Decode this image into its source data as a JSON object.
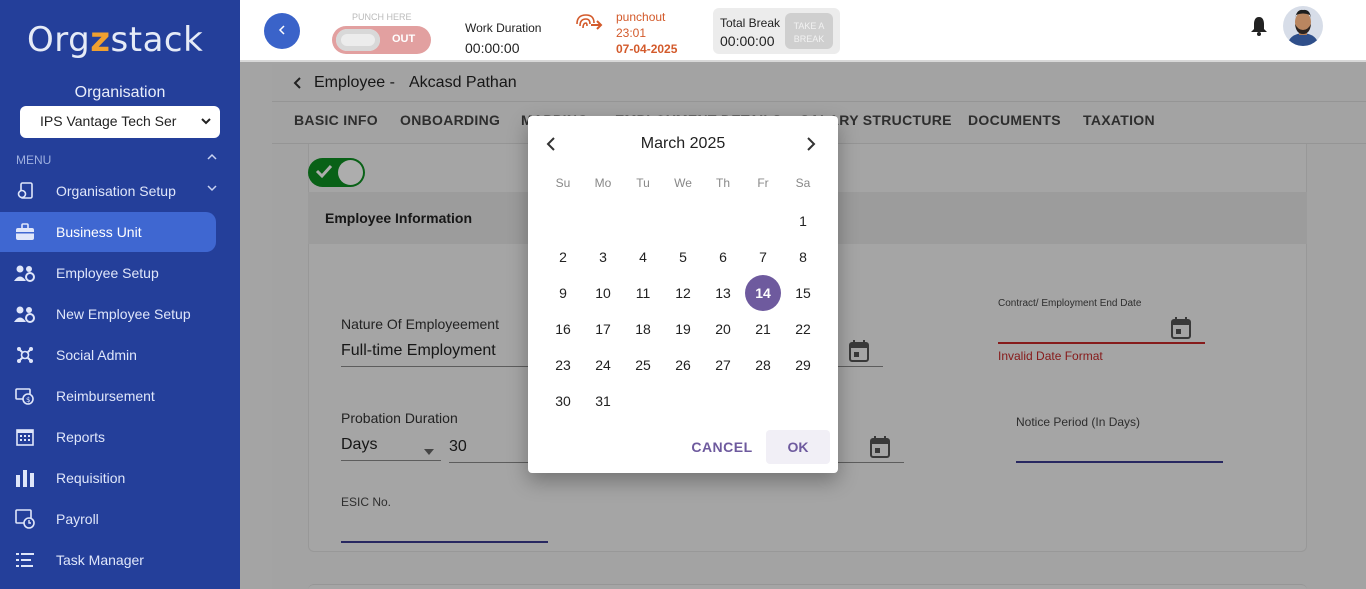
{
  "sidebar": {
    "logo": {
      "prefix": "Org",
      "mid": "z",
      "suffix": "stack"
    },
    "organisation_label": "Organisation",
    "organisation_selected": "IPS Vantage Tech Ser",
    "menu_label": "MENU",
    "items": [
      {
        "label": "Organisation Setup",
        "icon": "settings-doc-icon"
      },
      {
        "label": "Business Unit",
        "icon": "briefcase-icon"
      },
      {
        "label": "Employee Setup",
        "icon": "people-gear-icon"
      },
      {
        "label": "New Employee Setup",
        "icon": "people-gear-icon"
      },
      {
        "label": "Social Admin",
        "icon": "network-icon"
      },
      {
        "label": "Reimbursement",
        "icon": "money-cycle-icon"
      },
      {
        "label": "Reports",
        "icon": "grid-calendar-icon"
      },
      {
        "label": "Requisition",
        "icon": "bar-chart-icon"
      },
      {
        "label": "Payroll",
        "icon": "payroll-icon"
      },
      {
        "label": "Task Manager",
        "icon": "list-icon"
      }
    ]
  },
  "header": {
    "punch_label": "PUNCH HERE",
    "punch_state": "OUT",
    "work_duration_title": "Work Duration",
    "work_duration_value": "00:00:00",
    "punch_status": "punchout",
    "punch_time": "23:01",
    "punch_date": "07-04-2025",
    "break_title": "Total Break",
    "break_value": "00:00:00",
    "take_break_label": "TAKE A BREAK"
  },
  "breadcrumb": {
    "prefix": "Employee -",
    "name": "Akcasd Pathan"
  },
  "tabs": [
    "BASIC INFO",
    "ONBOARDING",
    "MAPPING",
    "EMPLOYMENT DETAILS",
    "SALARY STRUCTURE",
    "DOCUMENTS",
    "TAXATION"
  ],
  "form": {
    "section_title": "Employee Information",
    "nature_label": "Nature Of Employeement",
    "nature_value": "Full-time Employment",
    "contract_end_label": "Contract/ Employment End Date",
    "contract_end_error": "Invalid Date Format",
    "probation_label": "Probation Duration",
    "probation_unit": "Days",
    "probation_value": "30",
    "notice_label": "Notice Period (In Days)",
    "esic_label": "ESIC No."
  },
  "datepicker": {
    "month_title": "March 2025",
    "weekdays": [
      "Su",
      "Mo",
      "Tu",
      "We",
      "Th",
      "Fr",
      "Sa"
    ],
    "first_weekday_index": 6,
    "days_in_month": 31,
    "selected_day": 14,
    "cancel_label": "CANCEL",
    "ok_label": "OK"
  },
  "colors": {
    "sidebar_bg": "#243f9a",
    "active_item": "#3f67d1",
    "accent_purple": "#6e5a9e",
    "error_red": "#c62828",
    "punch_orange": "#d35a2b"
  }
}
